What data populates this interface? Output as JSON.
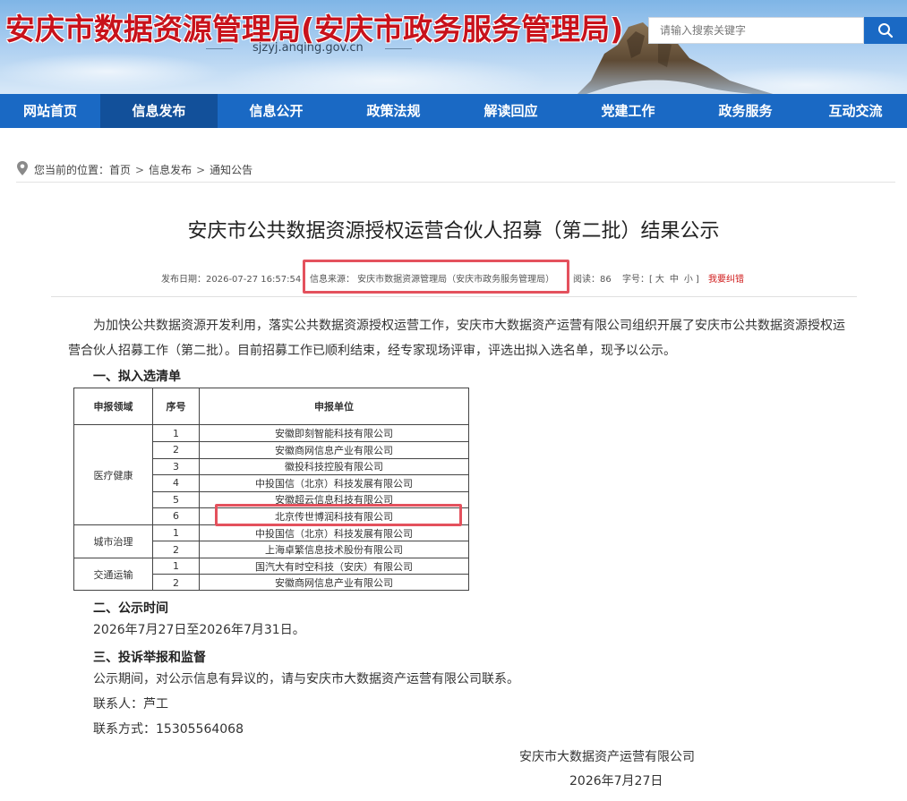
{
  "header": {
    "site_title": "安庆市数据资源管理局(安庆市政务服务管理局)",
    "domain": "sjzyj.anqing.gov.cn",
    "search_placeholder": "请输入搜索关键字"
  },
  "nav": {
    "items": [
      "网站首页",
      "信息发布",
      "信息公开",
      "政策法规",
      "解读回应",
      "党建工作",
      "政务服务",
      "互动交流"
    ],
    "active_index": 1
  },
  "breadcrumb": {
    "prefix": "您当前的位置：",
    "items": [
      "首页",
      "信息发布",
      "通知公告"
    ]
  },
  "article": {
    "title": "安庆市公共数据资源授权运营合伙人招募（第二批）结果公示",
    "meta": {
      "date": "发布日期：2026-07-27 16:57:54",
      "source": "信息来源： 安庆市数据资源管理局（安庆市政务服务管理局）",
      "reads": "阅读：86",
      "fontsize_label": "字号：[",
      "fontsize_large": "大",
      "fontsize_medium": "中",
      "fontsize_small": "小",
      "fontsize_end": "]",
      "report": "我要纠错"
    },
    "intro_line1": "为加快公共数据资源开发利用，落实公共数据资源授权运营工作，安庆市大数据资产运营有限公司组织开展了安庆市公共数据资源授权运",
    "intro_line2": "营合伙人招募工作（第二批）。目前招募工作已顺利结束，经专家现场评审，评选出拟入选名单，现予以公示。",
    "section1": "一、拟入选清单",
    "table": {
      "headers": [
        "申报领域",
        "序号",
        "申报单位"
      ],
      "groups": [
        {
          "domain": "医疗健康",
          "rows": [
            [
              "1",
              "安徽即刻智能科技有限公司"
            ],
            [
              "2",
              "安徽商网信息产业有限公司"
            ],
            [
              "3",
              "徽投科技控股有限公司"
            ],
            [
              "4",
              "中投国信（北京）科技发展有限公司"
            ],
            [
              "5",
              "安徽超云信息科技有限公司"
            ],
            [
              "6",
              "北京传世博润科技有限公司"
            ]
          ]
        },
        {
          "domain": "城市治理",
          "rows": [
            [
              "1",
              "中投国信（北京）科技发展有限公司"
            ],
            [
              "2",
              "上海卓繁信息技术股份有限公司"
            ]
          ]
        },
        {
          "domain": "交通运输",
          "rows": [
            [
              "1",
              "国汽大有时空科技（安庆）有限公司"
            ],
            [
              "2",
              "安徽商网信息产业有限公司"
            ]
          ]
        }
      ]
    },
    "section2": "二、公示时间",
    "period": "2026年7月27日至2026年7月31日。",
    "section3": "三、投诉举报和监督",
    "complaint": "公示期间，对公示信息有异议的，请与安庆市大数据资产运营有限公司联系。",
    "contact_person": "联系人：芦工",
    "contact_phone": "联系方式：15305564068",
    "signer": "安庆市大数据资产运营有限公司",
    "sign_date": "2026年7月27日"
  },
  "colors": {
    "brand_blue": "#1a69c4",
    "nav_active": "#12509a",
    "title_red": "#c8121b",
    "highlight_red": "#e4515d"
  }
}
